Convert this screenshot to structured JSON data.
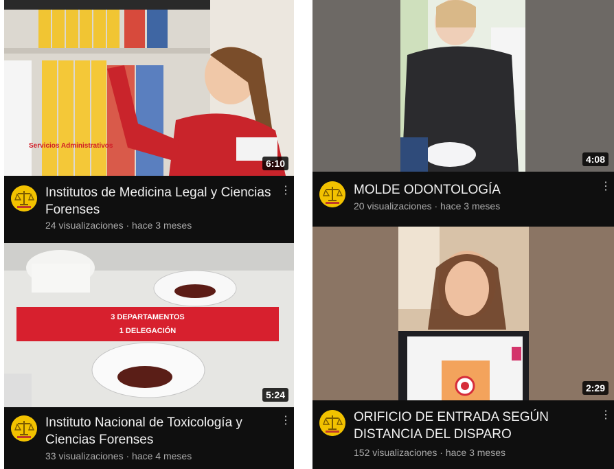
{
  "videos": [
    {
      "title": "Institutos de Medicina Legal y Ciencias Forenses",
      "stats": "24 visualizaciones · hace 3 meses",
      "duration": "6:10",
      "overlay_text": "Servicios Administrativos"
    },
    {
      "title": "Instituto Nacional de Toxicología y Ciencias Forenses",
      "stats": "33 visualizaciones · hace 4 meses",
      "duration": "5:24",
      "banner_line1": "3 DEPARTAMENTOS",
      "banner_line2": "1 DELEGACIÓN"
    },
    {
      "title": "MOLDE ODONTOLOGÍA",
      "stats": "20 visualizaciones · hace 3 meses",
      "duration": "4:08"
    },
    {
      "title": "ORIFICIO DE ENTRADA SEGÚN DISTANCIA DEL DISPARO",
      "stats": "152 visualizaciones · hace 3 meses",
      "duration": "2:29"
    }
  ],
  "channel_avatar_icon": "scales-of-justice-icon",
  "menu_icon": "more-vert-icon",
  "colors": {
    "background": "#0f0f0f",
    "title": "#f1f1f1",
    "stats": "#aaaaaa",
    "avatar": "#f2c200",
    "banner": "#d7202e"
  }
}
